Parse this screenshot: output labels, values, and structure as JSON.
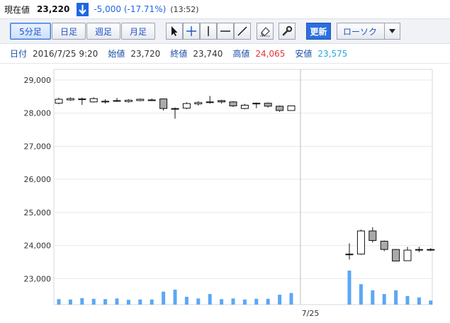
{
  "header": {
    "price_label": "現在値",
    "price_value": "23,220",
    "change": "-5,000 (-17.71%)",
    "change_time": "(13:52)"
  },
  "toolbar": {
    "periods": [
      "5分足",
      "日足",
      "週足",
      "月足"
    ],
    "active_period": "5分足",
    "update_label": "更新",
    "chart_type_value": "ローソク"
  },
  "info": {
    "date_label": "日付",
    "date_value": "2016/7/25 9:20",
    "open_label": "始値",
    "open_value": "23,720",
    "close_label": "終値",
    "close_value": "23,740",
    "high_label": "高値",
    "high_value": "24,065",
    "low_label": "安値",
    "low_value": "23,575"
  },
  "colors": {
    "accent": "#1f66e5",
    "high": "#e5343b",
    "low": "#27a7e0",
    "volume_bar": "#5ba8f5",
    "down_candle": "#aaaaaa"
  },
  "chart_data": {
    "type": "candlestick",
    "title": "",
    "xlabel": "",
    "ylabel": "",
    "ylim": [
      22000,
      29300
    ],
    "yticks": [
      23000,
      24000,
      25000,
      26000,
      27000,
      28000,
      29000
    ],
    "ytick_labels": [
      "23,000",
      "24,000",
      "25,000",
      "26,000",
      "27,000",
      "28,000",
      "29,000"
    ],
    "x_tick_label": "7/25",
    "grid": true,
    "candles": [
      {
        "open": 28300,
        "high": 28470,
        "low": 28270,
        "close": 28420
      },
      {
        "open": 28400,
        "high": 28480,
        "low": 28370,
        "close": 28440
      },
      {
        "open": 28430,
        "high": 28470,
        "low": 28250,
        "close": 28420
      },
      {
        "open": 28340,
        "high": 28480,
        "low": 28320,
        "close": 28440
      },
      {
        "open": 28360,
        "high": 28420,
        "low": 28290,
        "close": 28360
      },
      {
        "open": 28380,
        "high": 28460,
        "low": 28340,
        "close": 28380
      },
      {
        "open": 28350,
        "high": 28420,
        "low": 28320,
        "close": 28390
      },
      {
        "open": 28380,
        "high": 28440,
        "low": 28360,
        "close": 28420
      },
      {
        "open": 28400,
        "high": 28440,
        "low": 28380,
        "close": 28400
      },
      {
        "open": 28430,
        "high": 28440,
        "low": 28080,
        "close": 28140
      },
      {
        "open": 28140,
        "high": 28170,
        "low": 27830,
        "close": 28140
      },
      {
        "open": 28150,
        "high": 28330,
        "low": 28120,
        "close": 28290
      },
      {
        "open": 28280,
        "high": 28360,
        "low": 28230,
        "close": 28320
      },
      {
        "open": 28340,
        "high": 28520,
        "low": 28290,
        "close": 28340
      },
      {
        "open": 28380,
        "high": 28400,
        "low": 28290,
        "close": 28340
      },
      {
        "open": 28340,
        "high": 28360,
        "low": 28190,
        "close": 28220
      },
      {
        "open": 28140,
        "high": 28280,
        "low": 28120,
        "close": 28240
      },
      {
        "open": 28300,
        "high": 28320,
        "low": 28150,
        "close": 28300
      },
      {
        "open": 28300,
        "high": 28320,
        "low": 28170,
        "close": 28210
      },
      {
        "open": 28210,
        "high": 28230,
        "low": 28040,
        "close": 28080
      },
      {
        "open": 28080,
        "high": 28230,
        "low": 28070,
        "close": 28220
      },
      {
        "gap": true
      },
      {
        "gap": true
      },
      {
        "gap": true
      },
      {
        "gap": true
      },
      {
        "open": 23740,
        "high": 24065,
        "low": 23575,
        "close": 23720
      },
      {
        "open": 23740,
        "high": 24480,
        "low": 23720,
        "close": 24440
      },
      {
        "open": 24440,
        "high": 24550,
        "low": 24090,
        "close": 24150
      },
      {
        "open": 24130,
        "high": 24150,
        "low": 23830,
        "close": 23880
      },
      {
        "open": 23880,
        "high": 23890,
        "low": 23530,
        "close": 23530
      },
      {
        "open": 23540,
        "high": 23960,
        "low": 23530,
        "close": 23860
      },
      {
        "open": 23860,
        "high": 23960,
        "low": 23800,
        "close": 23880
      },
      {
        "open": 23880,
        "high": 23920,
        "low": 23830,
        "close": 23880
      }
    ],
    "volume": [
      0.16,
      0.15,
      0.19,
      0.17,
      0.16,
      0.18,
      0.14,
      0.15,
      0.15,
      0.38,
      0.44,
      0.23,
      0.18,
      0.31,
      0.16,
      0.18,
      0.15,
      0.17,
      0.17,
      0.29,
      0.34,
      0,
      0,
      0,
      0,
      1.0,
      0.6,
      0.42,
      0.31,
      0.42,
      0.25,
      0.21,
      0.12
    ]
  }
}
